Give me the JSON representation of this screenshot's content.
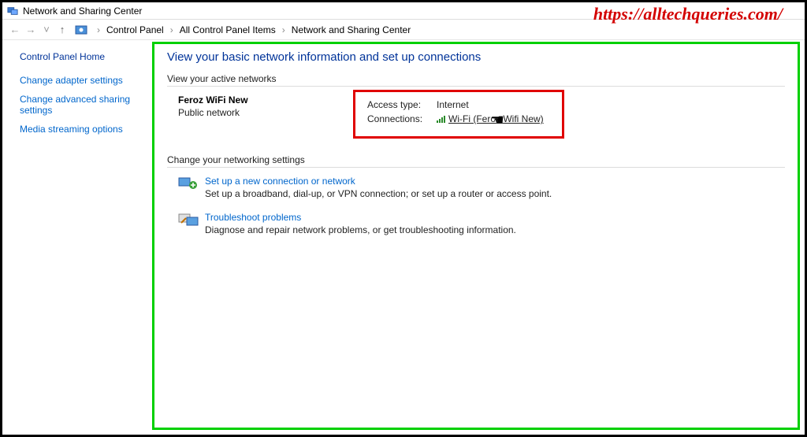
{
  "watermark": "https://alltechqueries.com/",
  "title_bar": {
    "title": "Network and Sharing Center"
  },
  "breadcrumb": {
    "items": [
      "Control Panel",
      "All Control Panel Items",
      "Network and Sharing Center"
    ]
  },
  "sidebar": {
    "home": "Control Panel Home",
    "links": [
      "Change adapter settings",
      "Change advanced sharing settings",
      "Media streaming options"
    ]
  },
  "main": {
    "heading": "View your basic network information and set up connections",
    "active_networks_label": "View your active networks",
    "network": {
      "name": "Feroz WiFi New",
      "category": "Public network",
      "access_type_label": "Access type:",
      "access_type_value": "Internet",
      "connections_label": "Connections:",
      "connection_link": "Wi-Fi (Feroz Wifi New)"
    },
    "change_settings_label": "Change your networking settings",
    "actions": [
      {
        "title": "Set up a new connection or network",
        "desc": "Set up a broadband, dial-up, or VPN connection; or set up a router or access point."
      },
      {
        "title": "Troubleshoot problems",
        "desc": "Diagnose and repair network problems, or get troubleshooting information."
      }
    ]
  }
}
